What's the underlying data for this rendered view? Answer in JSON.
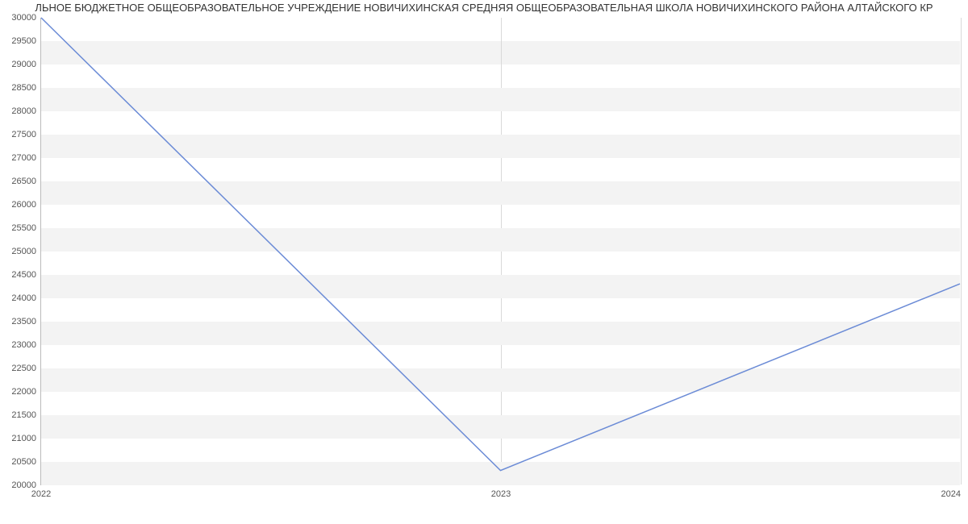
{
  "chart_data": {
    "type": "line",
    "title": "ЛЬНОЕ БЮДЖЕТНОЕ ОБЩЕОБРАЗОВАТЕЛЬНОЕ УЧРЕЖДЕНИЕ НОВИЧИХИНСКАЯ СРЕДНЯЯ ОБЩЕОБРАЗОВАТЕЛЬНАЯ ШКОЛА НОВИЧИХИНСКОГО РАЙОНА АЛТАЙСКОГО КР",
    "x": [
      2022,
      2023,
      2024
    ],
    "values": [
      30000,
      20300,
      24300
    ],
    "xlabel": "",
    "ylabel": "",
    "xlim": [
      2022,
      2024
    ],
    "ylim": [
      20000,
      30000
    ],
    "y_ticks": [
      20000,
      20500,
      21000,
      21500,
      22000,
      22500,
      23000,
      23500,
      24000,
      24500,
      25000,
      25500,
      26000,
      26500,
      27000,
      27500,
      28000,
      28500,
      29000,
      29500,
      30000
    ],
    "x_ticks": [
      2022,
      2023,
      2024
    ]
  }
}
